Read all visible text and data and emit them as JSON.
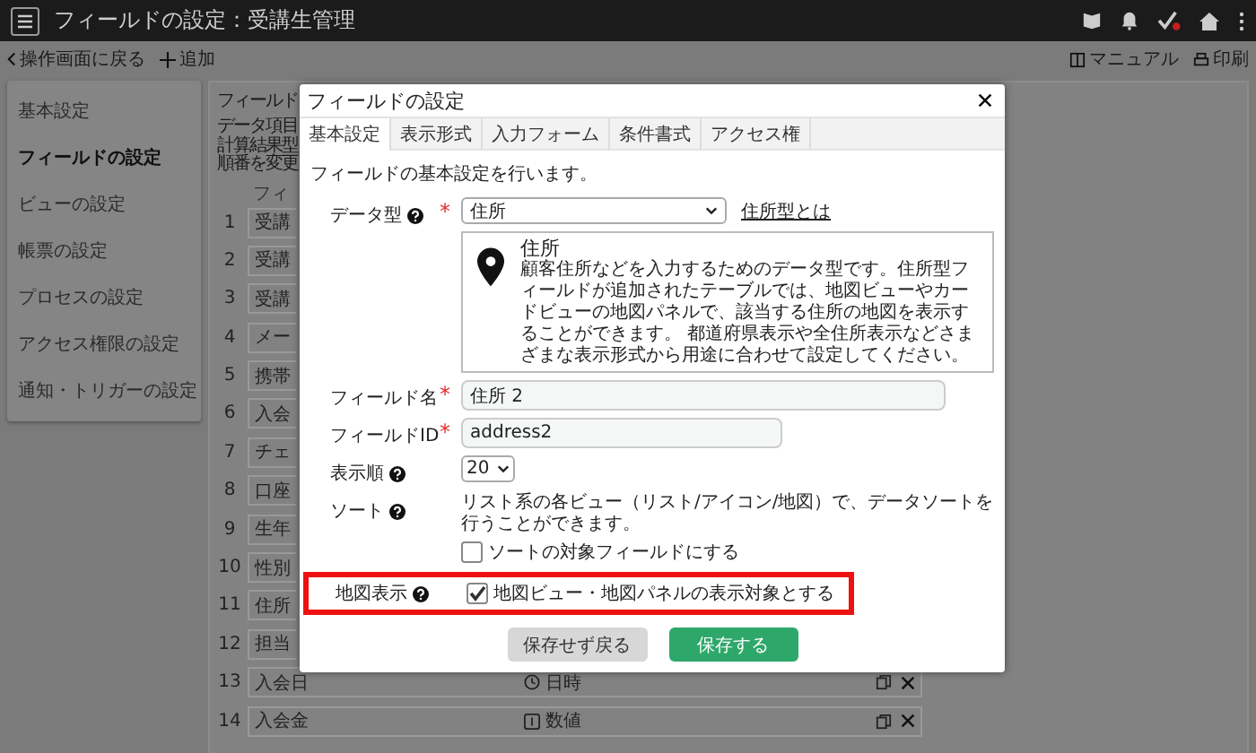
{
  "header": {
    "title": "フィールドの設定：受講生管理"
  },
  "toolbar": {
    "back": "操作画面に戻る",
    "add": "追加",
    "manual": "マニュアル",
    "print": "印刷"
  },
  "sidebar": {
    "items": [
      {
        "label": "基本設定",
        "selected": false
      },
      {
        "label": "フィールドの設定",
        "selected": true
      },
      {
        "label": "ビューの設定",
        "selected": false
      },
      {
        "label": "帳票の設定",
        "selected": false
      },
      {
        "label": "プロセスの設定",
        "selected": false
      },
      {
        "label": "アクセス権限の設定",
        "selected": false
      },
      {
        "label": "通知・トリガーの設定",
        "selected": false
      }
    ]
  },
  "main": {
    "title": "フィールド",
    "notes": [
      "データ項目",
      "計算結果型",
      "順番を変更"
    ],
    "column_header": "フィ",
    "rows": [
      {
        "number": "1",
        "name": "受講",
        "kind": "partial"
      },
      {
        "number": "2",
        "name": "受講",
        "kind": "partial"
      },
      {
        "number": "3",
        "name": "受講",
        "kind": "partial"
      },
      {
        "number": "4",
        "name": "メー",
        "kind": "partial"
      },
      {
        "number": "5",
        "name": "携帯",
        "kind": "partial"
      },
      {
        "number": "6",
        "name": "入会",
        "kind": "partial"
      },
      {
        "number": "7",
        "name": "チェ",
        "kind": "partial"
      },
      {
        "number": "8",
        "name": "口座",
        "kind": "partial"
      },
      {
        "number": "9",
        "name": "生年",
        "kind": "partial"
      },
      {
        "number": "10",
        "name": "性別",
        "kind": "partial"
      },
      {
        "number": "11",
        "name": "住所",
        "kind": "partial"
      },
      {
        "number": "12",
        "name": "担当",
        "kind": "partial"
      },
      {
        "number": "13",
        "name": "入会日",
        "kind": "datetime",
        "type": "日時"
      },
      {
        "number": "14",
        "name": "入会金",
        "kind": "number",
        "type": "数値"
      }
    ]
  },
  "modal": {
    "title": "フィールドの設定",
    "tabs": [
      {
        "label": "基本設定",
        "selected": true
      },
      {
        "label": "表示形式",
        "selected": false
      },
      {
        "label": "入力フォーム",
        "selected": false
      },
      {
        "label": "条件書式",
        "selected": false
      },
      {
        "label": "アクセス権",
        "selected": false
      }
    ],
    "intro": "フィールドの基本設定を行います。",
    "data_type": {
      "label": "データ型",
      "required": "*",
      "value": "住所",
      "link": "住所型とは",
      "info_title": "住所",
      "info_text": "顧客住所などを入力するためのデータ型です。住所型フィールドが追加されたテーブルでは、地図ビューやカードビューの地図パネルで、該当する住所の地図を表示することができます。 都道府県表示や全住所表示などさまざまな表示形式から用途に合わせて設定してください。"
    },
    "field_name": {
      "label": "フィールド名",
      "required": "*",
      "value": "住所 2"
    },
    "field_id": {
      "label": "フィールドID",
      "required": "*",
      "value": "address2"
    },
    "display_order": {
      "label": "表示順",
      "value": "20"
    },
    "sort": {
      "label": "ソート",
      "text": "リスト系の各ビュー（リスト/アイコン/地図）で、データソートを行うことができます。",
      "checkbox": "ソートの対象フィールドにする",
      "checked": false
    },
    "map": {
      "label": "地図表示",
      "checkbox": "地図ビュー・地図パネルの表示対象とする",
      "checked": true,
      "highlighted": true
    },
    "buttons": {
      "cancel": "保存せず戻る",
      "save": "保存する"
    }
  }
}
